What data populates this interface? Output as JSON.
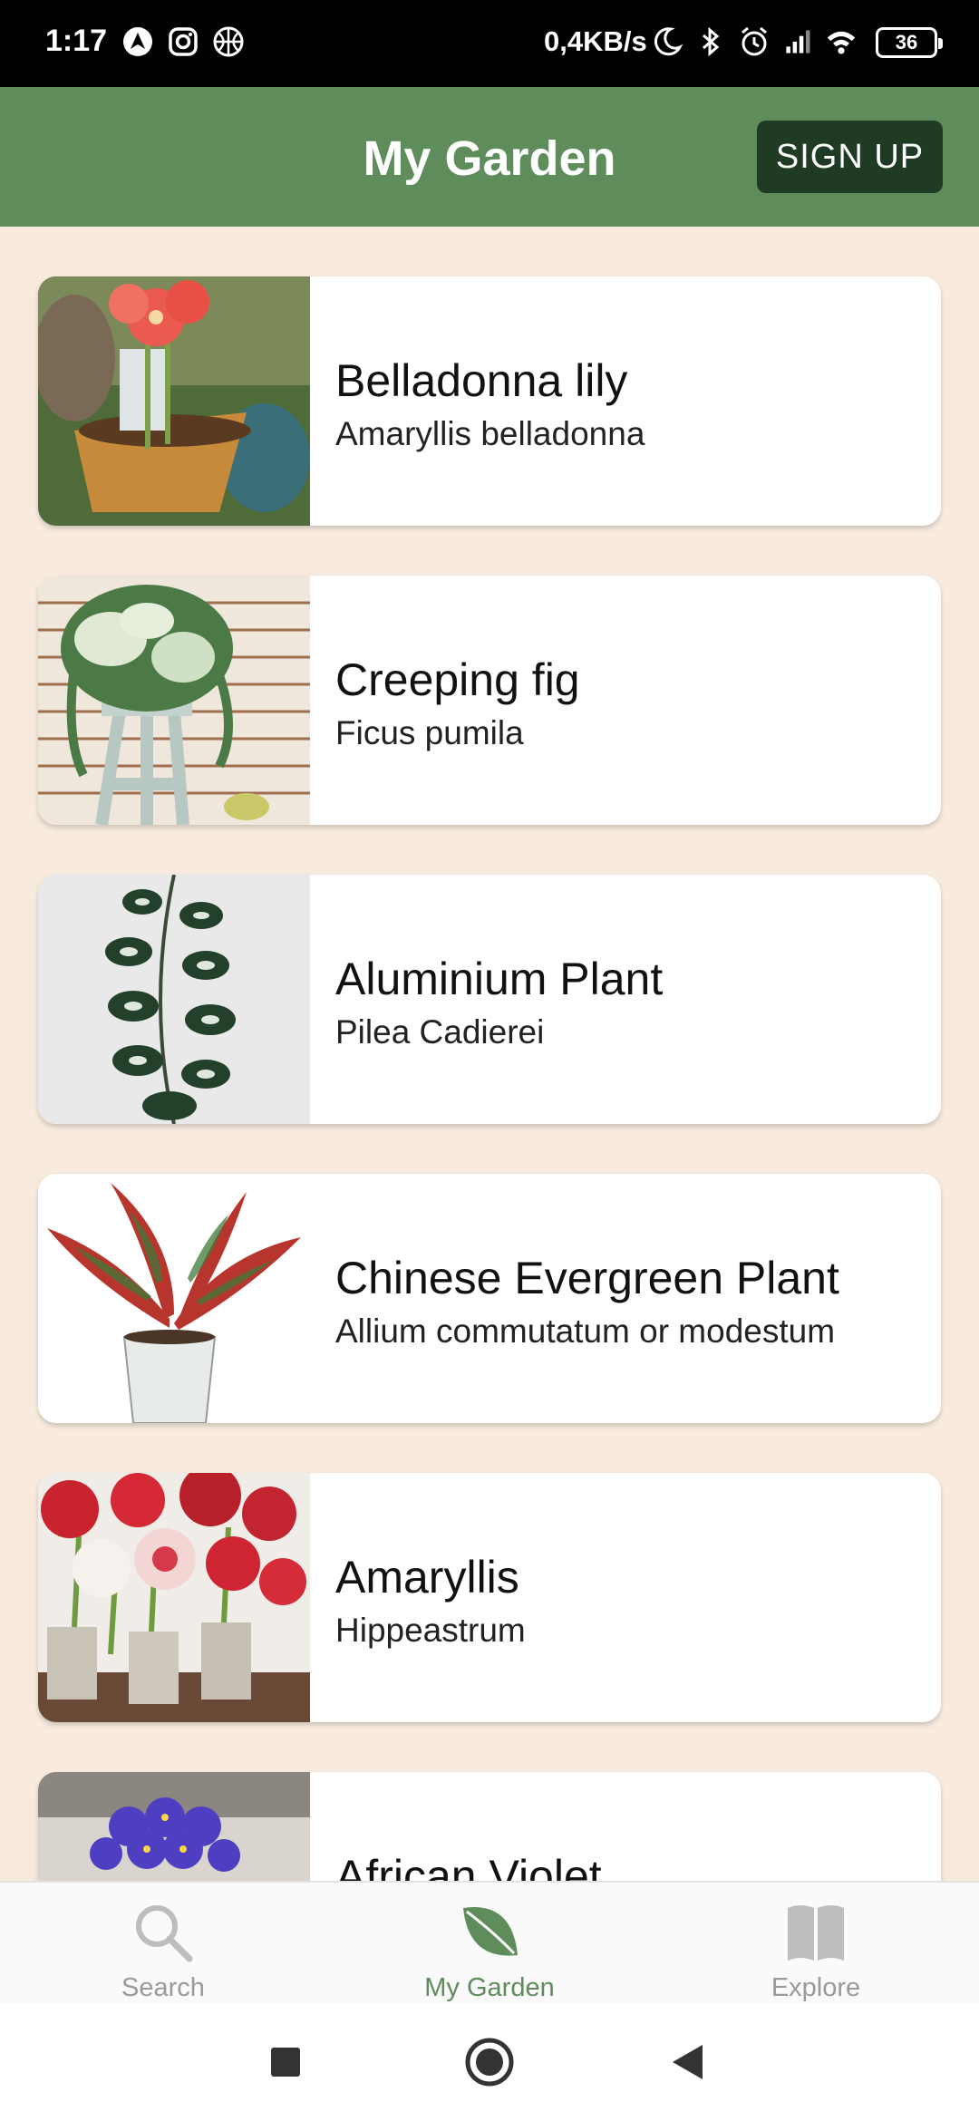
{
  "status_bar": {
    "time": "1:17",
    "net_speed": "0,4KB/s",
    "battery": "36",
    "left_icons": [
      "navigation-icon",
      "instagram-icon",
      "basketball-icon"
    ],
    "right_icons": [
      "moon-icon",
      "bluetooth-icon",
      "alarm-icon",
      "signal-icon",
      "wifi-icon",
      "battery-icon"
    ]
  },
  "header": {
    "title": "My Garden",
    "signup_label": "SIGN UP"
  },
  "plants": [
    {
      "name": "Belladonna lily",
      "scientific": "Amaryllis belladonna",
      "image": "belladonna-lily-photo"
    },
    {
      "name": "Creeping fig",
      "scientific": "Ficus pumila",
      "image": "creeping-fig-photo"
    },
    {
      "name": "Aluminium Plant",
      "scientific": "Pilea Cadierei",
      "image": "aluminium-plant-photo"
    },
    {
      "name": "Chinese Evergreen Plant",
      "scientific": "Allium commutatum or modestum",
      "image": "chinese-evergreen-photo"
    },
    {
      "name": "Amaryllis",
      "scientific": "Hippeastrum",
      "image": "amaryllis-photo"
    },
    {
      "name": "African Violet",
      "scientific": "",
      "image": "african-violet-photo"
    }
  ],
  "bottom_nav": [
    {
      "label": "Search",
      "icon": "search-icon",
      "active": false
    },
    {
      "label": "My Garden",
      "icon": "leaf-icon",
      "active": true
    },
    {
      "label": "Explore",
      "icon": "book-icon",
      "active": false
    }
  ],
  "colors": {
    "header": "#5e8c5a",
    "signup_button": "#1f3b23",
    "background": "#f8ebde",
    "active_nav": "#5e8c5a",
    "inactive_nav": "#9a9a9a"
  },
  "system_nav": [
    "recents-button",
    "home-button",
    "back-button"
  ]
}
